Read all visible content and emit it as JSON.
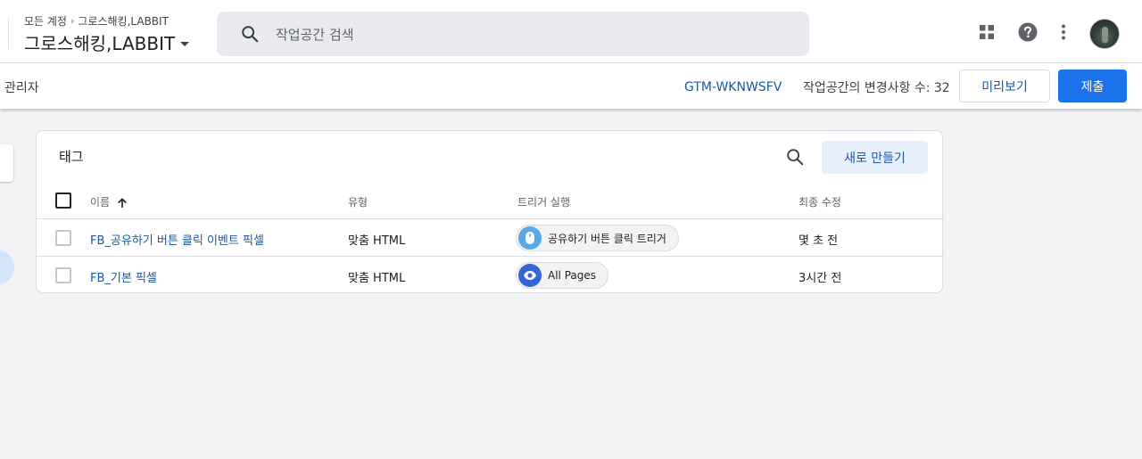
{
  "header": {
    "breadcrumb_root": "모든 계정",
    "breadcrumb_sep": "›",
    "breadcrumb_account": "그로스해킹,LABBIT",
    "container_name": "그로스해킹,LABBIT",
    "search_placeholder": "작업공간 검색",
    "icons": [
      "apps-grid-icon",
      "help-icon",
      "more-vert-icon",
      "avatar"
    ]
  },
  "subbar": {
    "left_label": "관리자",
    "container_id": "GTM-WKNWSFV",
    "workspace_changes": "작업공간의 변경사항 수: 32",
    "preview_label": "미리보기",
    "submit_label": "제출"
  },
  "tags_card": {
    "title": "태그",
    "new_button_label": "새로 만들기",
    "columns": [
      "이름",
      "유형",
      "트리거 실행",
      "최종 수정"
    ],
    "sort_column": "이름",
    "rows": [
      {
        "name": "FB_공유하기 버튼 클릭 이벤트 픽셀",
        "type": "맞춤 HTML",
        "trigger": "공유하기 버튼 클릭 트리거",
        "trigger_icon": "mouse-icon",
        "modified": "몇 초 전"
      },
      {
        "name": "FB_기본 픽셀",
        "type": "맞춤 HTML",
        "trigger": "All Pages",
        "trigger_icon": "eye-icon",
        "modified": "3시간 전"
      }
    ]
  },
  "colors": {
    "accent": "#1a73e8",
    "link": "#1a57a3",
    "background": "#f1f3f4",
    "chip_mouse": "#5aa8e6",
    "chip_eye": "#3367d6"
  }
}
